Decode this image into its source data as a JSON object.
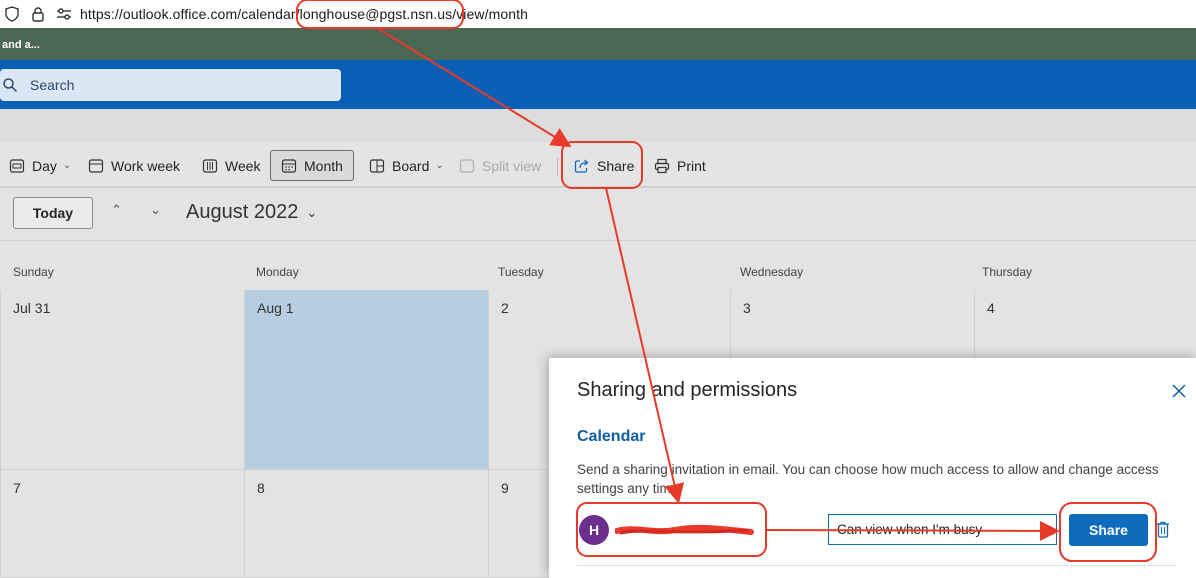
{
  "browser": {
    "url": "https://outlook.office.com/calendar/longhouse@pgst.nsn.us/view/month"
  },
  "banner": {
    "text": "and a..."
  },
  "header": {
    "search_label": "Search"
  },
  "toolbar": {
    "day": "Day",
    "work_week": "Work week",
    "week": "Week",
    "month": "Month",
    "board": "Board",
    "split_view": "Split view",
    "share": "Share",
    "print": "Print"
  },
  "calendar": {
    "today_label": "Today",
    "month_title": "August 2022",
    "weekdays": [
      "Sunday",
      "Monday",
      "Tuesday",
      "Wednesday",
      "Thursday"
    ],
    "week1": [
      "Jul 31",
      "Aug 1",
      "2",
      "3",
      "4"
    ],
    "week2": [
      "7",
      "8",
      "9"
    ]
  },
  "dialog": {
    "title": "Sharing and permissions",
    "section": "Calendar",
    "description": "Send a sharing invitation in email. You can choose how much access to allow and change access settings any time.",
    "avatar_initial": "H",
    "permission": "Can view when I'm busy",
    "share_label": "Share"
  },
  "colors": {
    "accent": "#0f6cbd",
    "annotation": "#e8392b",
    "header_blue": "#0a5fb4",
    "banner_green": "#4a6754"
  }
}
